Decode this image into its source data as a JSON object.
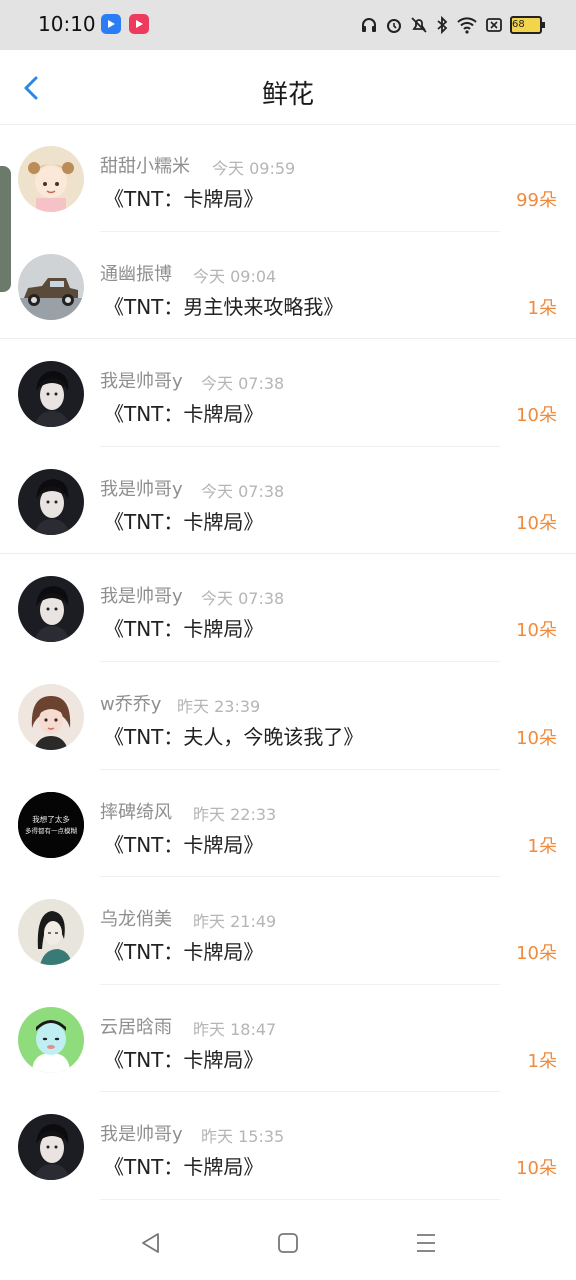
{
  "status_bar": {
    "time": "10:10",
    "battery": "68",
    "app_icons": [
      "blue-app-icon",
      "red-video-app-icon"
    ],
    "system_icons": [
      "headphones-icon",
      "alarm-icon",
      "mute-icon",
      "bluetooth-icon",
      "wifi-icon",
      "sim-off-icon",
      "battery-icon"
    ]
  },
  "header": {
    "title": "鲜花",
    "back_icon": "chevron-left-icon"
  },
  "colors": {
    "accent": "#2b86e4",
    "quantity": "#f08a3c"
  },
  "records": [
    {
      "user": "甜甜小糯米",
      "time": "今天 09:59",
      "book": "《TNT：卡牌局》",
      "quantity": "99朵",
      "avatar": "cartoon-girl-avatar"
    },
    {
      "user": "通幽振博",
      "time": "今天 09:04",
      "book": "《TNT：男主快来攻略我》",
      "quantity": "1朵",
      "avatar": "vintage-car-avatar"
    },
    {
      "user": "我是帅哥y",
      "time": "今天 07:38",
      "book": "《TNT：卡牌局》",
      "quantity": "10朵",
      "avatar": "dark-portrait-avatar"
    },
    {
      "user": "我是帅哥y",
      "time": "今天 07:38",
      "book": "《TNT：卡牌局》",
      "quantity": "10朵",
      "avatar": "dark-portrait-avatar"
    },
    {
      "user": "我是帅哥y",
      "time": "今天 07:38",
      "book": "《TNT：卡牌局》",
      "quantity": "10朵",
      "avatar": "dark-portrait-avatar"
    },
    {
      "user": "w乔乔y",
      "time": "昨天 23:39",
      "book": "《TNT：夫人，今晚该我了》",
      "quantity": "10朵",
      "avatar": "girl-portrait-avatar"
    },
    {
      "user": "摔碑绮风",
      "time": "昨天 22:33",
      "book": "《TNT：卡牌局》",
      "quantity": "1朵",
      "avatar": "black-text-avatar",
      "avatar_text": [
        "我想了太多",
        "多得都有一点模糊"
      ]
    },
    {
      "user": "乌龙俏美",
      "time": "昨天 21:49",
      "book": "《TNT：卡牌局》",
      "quantity": "10朵",
      "avatar": "ink-painting-avatar"
    },
    {
      "user": "云居晗雨",
      "time": "昨天 18:47",
      "book": "《TNT：卡牌局》",
      "quantity": "1朵",
      "avatar": "cartoon-green-avatar"
    },
    {
      "user": "我是帅哥y",
      "time": "昨天 15:35",
      "book": "《TNT：卡牌局》",
      "quantity": "10朵",
      "avatar": "dark-portrait-avatar"
    }
  ],
  "bottom_nav": [
    "back-triangle-icon",
    "home-square-icon",
    "menu-lines-icon"
  ]
}
